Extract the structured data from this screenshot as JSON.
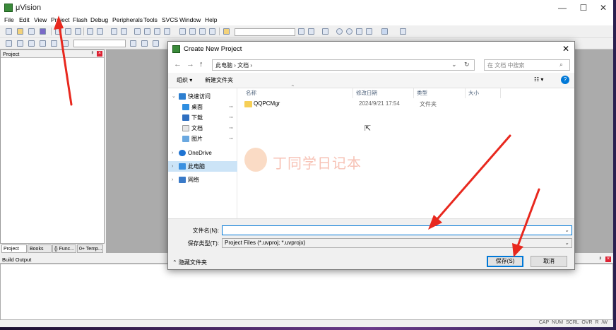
{
  "window": {
    "title": "μVision",
    "minimize": "—",
    "maximize": "☐",
    "close": "✕"
  },
  "menu": [
    "File",
    "Edit",
    "View",
    "Project",
    "Flash",
    "Debug",
    "Peripherals",
    "Tools",
    "SVCS",
    "Window",
    "Help"
  ],
  "project_pane": {
    "title": "Project",
    "pin": "ᵖ",
    "close": "×",
    "tabs": [
      "Project",
      "Books",
      "{} Func...",
      "0+ Temp..."
    ]
  },
  "build_output": {
    "title": "Build Output",
    "pin": "ᵖ",
    "close": "×"
  },
  "status_bar": {
    "indicators": "CAP  NUM  SCRL  OVR  R /W"
  },
  "dialog": {
    "title": "Create New Project",
    "close": "✕",
    "nav": {
      "back": "←",
      "forward": "→",
      "up": "↑",
      "dropdown": "⌄",
      "refresh": "↻"
    },
    "address_path": "此电脑  ›  文档  ›",
    "search_placeholder": "在 文档 中搜索",
    "commands": {
      "organize": "组织 ▾",
      "new_folder": "新建文件夹",
      "view": "☷ ▾",
      "help": "?"
    },
    "nav_pane": {
      "quick_access": "快速访问",
      "quick_items": [
        "桌面",
        "下载",
        "文档",
        "图片"
      ],
      "onedrive": "OneDrive",
      "this_pc": "此电脑",
      "network": "网络"
    },
    "columns": [
      "名称",
      "修改日期",
      "类型",
      "大小"
    ],
    "files": [
      {
        "name": "QQPCMgr",
        "date": "2024/9/21 17:54",
        "type": "文件夹",
        "size": ""
      }
    ],
    "watermark": "丁同学日记本",
    "filename_label": "文件名(N):",
    "filename_value": "",
    "filetype_label": "保存类型(T):",
    "filetype_value": "Project Files (*.uvproj; *.uvprojx)",
    "hide_folders": "隐藏文件夹",
    "save_button": "保存(S)",
    "cancel_button": "取消"
  },
  "colors": {
    "accent": "#0078d7",
    "arrow": "#e8281e",
    "editor_bg": "#ababab"
  }
}
